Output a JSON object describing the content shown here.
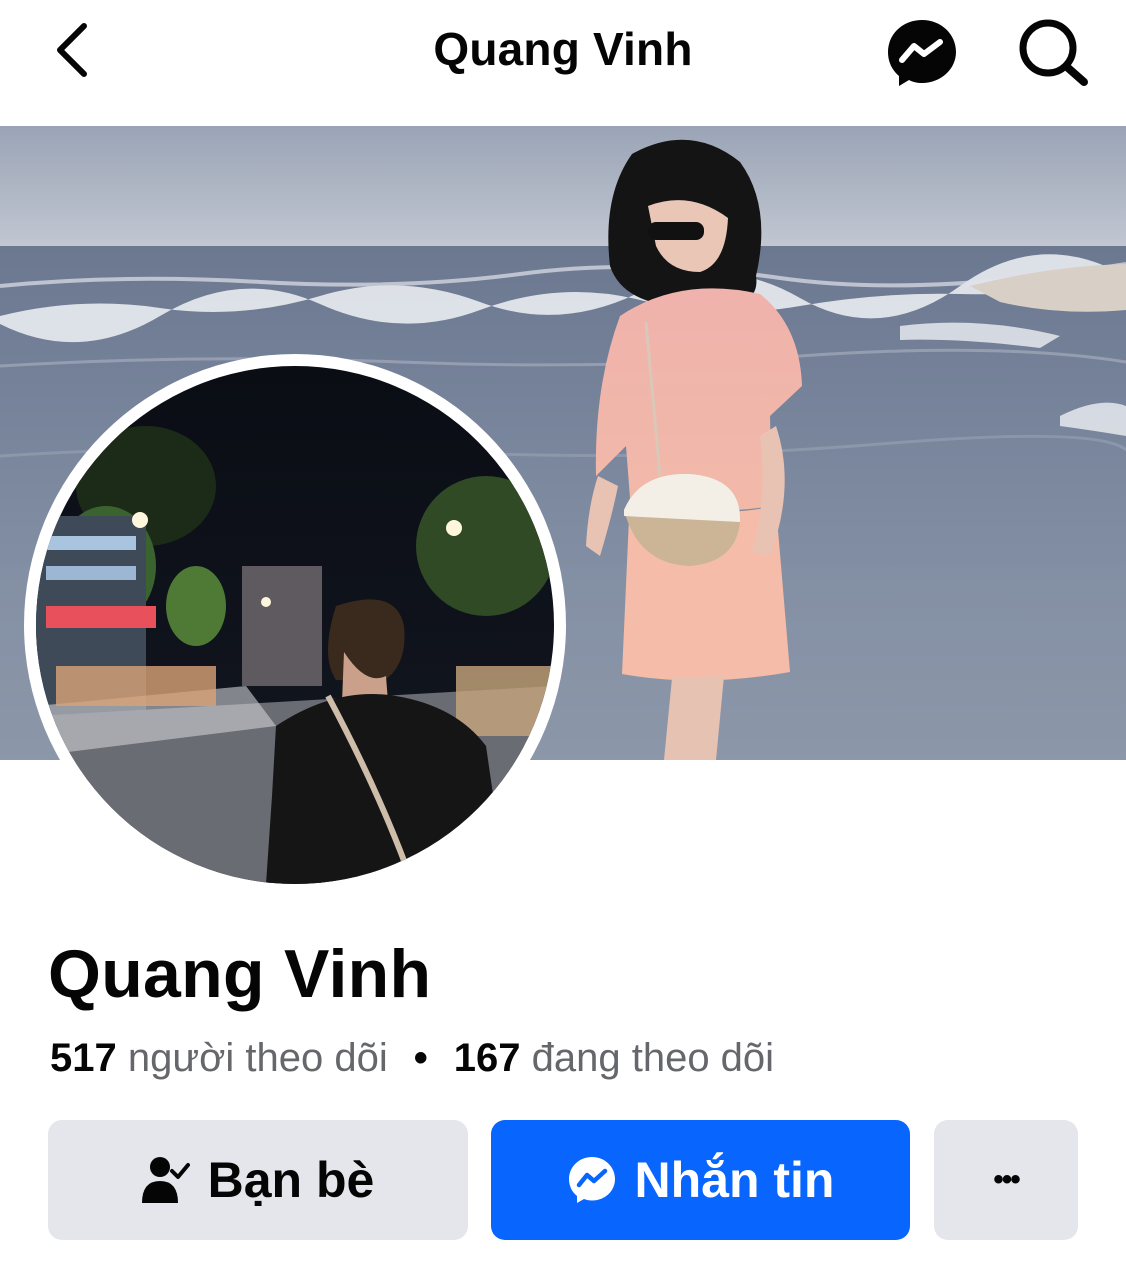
{
  "header": {
    "title": "Quang Vinh"
  },
  "profile": {
    "name": "Quang Vinh",
    "followers_count": "517",
    "followers_label": "người theo dõi",
    "separator": "•",
    "following_count": "167",
    "following_label": "đang theo dõi"
  },
  "actions": {
    "friends_label": "Bạn bè",
    "message_label": "Nhắn tin",
    "more_label": "•••"
  },
  "icons": {
    "back": "chevron-left-icon",
    "messenger": "messenger-icon",
    "search": "search-icon",
    "friends": "person-check-icon",
    "more": "more-horizontal-icon"
  },
  "colors": {
    "primary_blue": "#0866ff",
    "secondary_button": "#e4e6eb",
    "text_primary": "#050505",
    "text_secondary": "#65676b"
  }
}
